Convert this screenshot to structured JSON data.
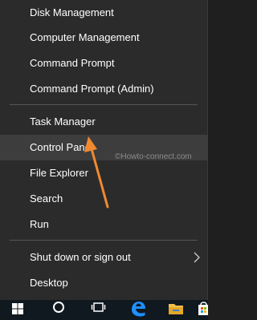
{
  "menu": {
    "items": [
      {
        "label": "Disk Management"
      },
      {
        "label": "Computer Management"
      },
      {
        "label": "Command Prompt"
      },
      {
        "label": "Command Prompt (Admin)"
      },
      {
        "label": "Task Manager"
      },
      {
        "label": "Control Panel"
      },
      {
        "label": "File Explorer"
      },
      {
        "label": "Search"
      },
      {
        "label": "Run"
      },
      {
        "label": "Shut down or sign out"
      },
      {
        "label": "Desktop"
      }
    ],
    "hovered_item": "Control Panel",
    "submenu_icon": "chevron-right-icon"
  },
  "watermark": "©Howto-connect.com",
  "colors": {
    "menu_background": "#2b2b2b",
    "hover_background": "#3d3d3d",
    "text": "#ffffff",
    "separator": "#555555",
    "pointer_arrow": "#f08a30",
    "taskbar": "#101820",
    "edge_blue": "#1e90ff",
    "explorer_folder": "#f2c04a"
  },
  "taskbar": {
    "icons": [
      "start-icon",
      "cortana-icon",
      "task-view-icon",
      "edge-icon",
      "file-explorer-icon",
      "store-icon"
    ]
  }
}
